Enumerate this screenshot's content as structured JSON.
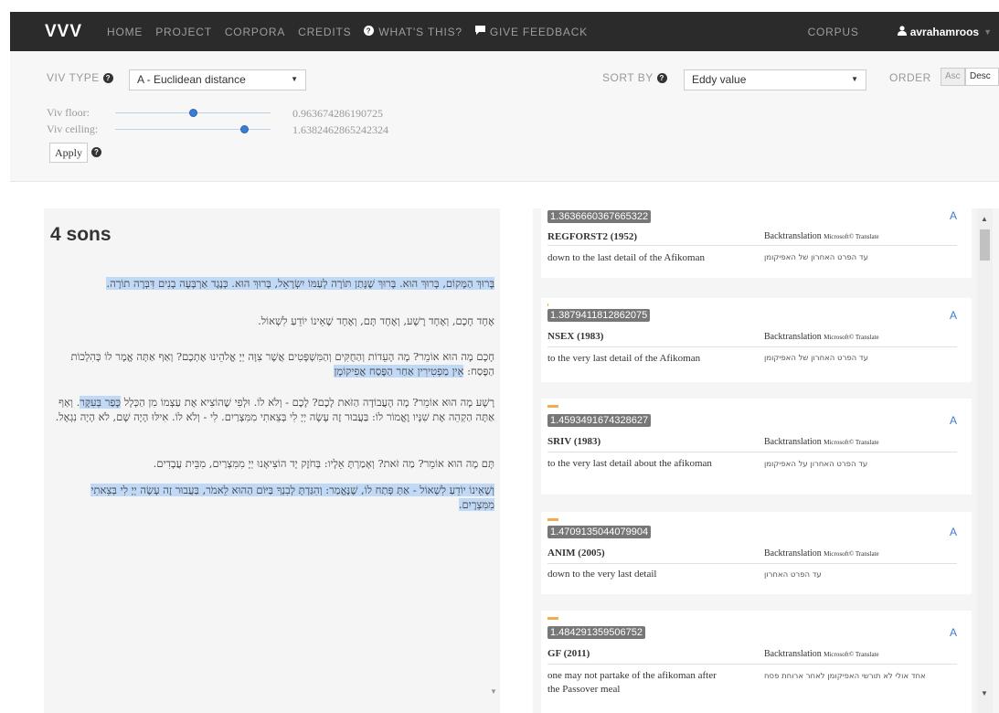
{
  "navbar": {
    "brand": "VVV",
    "links": [
      "HOME",
      "PROJECT",
      "CORPORA",
      "CREDITS"
    ],
    "whats_this": "WHAT'S THIS?",
    "feedback": "GIVE FEEDBACK",
    "corpus": "CORPUS",
    "user": "avrahamroos",
    "icons": {
      "whats_this": "question-circle-icon",
      "feedback": "comment-icon",
      "user": "user-icon"
    }
  },
  "controls": {
    "viv_type_label": "VIV TYPE",
    "viv_type_value": "A - Euclidean distance",
    "sort_by_label": "SORT BY",
    "sort_by_value": "Eddy value",
    "order_label": "ORDER",
    "order_asc": "Asc",
    "order_desc": "Desc",
    "order_selected": "Desc",
    "viv_floor_label": "Viv floor:",
    "viv_floor_value": "0.963674286190725",
    "viv_ceiling_label": "Viv ceiling:",
    "viv_ceiling_value": "1.6382462865242324",
    "apply": "Apply"
  },
  "text_panel": {
    "title": "4 sons",
    "paragraphs": [
      {
        "before": "",
        "highlight": "בָּרוּךְ הַמָּקוֹם, בָּרוּךְ הוּא. בָּרוּךְ שֶׁנָּתַן תּוֹרָה לְעַמּוֹ יִשְׂרָאֵל, בָּרוּךְ הוּא. כְּנֶגֶד אַרְבָּעָה בָנִים דִּבְּרָה תוֹרָה.",
        "after": ""
      },
      {
        "before": "אֶחָד חָכָם, וְאֶחָד רָשָׁע, וְאֶחָד תָּם, וְאֶחָד שֶׁאֵינוֹ יוֹדֵעַ לִשְׁאוֹל.",
        "highlight": "",
        "after": ""
      },
      {
        "before": "חָכָם מָה הוּא אוֹמֵר? מָה הָעֵדוֹת וְהַחֻקִּים וְהַמִּשְׁפָּטִים אֲשֶׁר צִוָּה יְיָ אֱלֹהֵינוּ אֶתְכֶם? וְאַף אַתָּה אֱמָר לוֹ כְּהִלְכוֹת הַפֶּסַח: ",
        "highlight": "אֵין מַפְטִירִין אַחַר הַפֶּסַח אֲפִיקוֹמָן",
        "after": ""
      },
      {
        "before": "רָשָׁע מָה הוּא אוֹמֵר? מָה הָעֲבוֹדָה הַזֹּאת לָכֶם? לָכֶם - וְלֹא לוֹ. וּלְפִי שֶׁהוֹצִיא אֶת עַצְמוֹ מִן הַכְּלָל ",
        "highlight": "כָּפַר בְּעִקָּר",
        "after": ". וְאַף אַתָּה הַקְהֵה אֶת שִׁנָּיו וֶאֱמוֹר לוֹ: בַּעֲבוּר זֶה עָשָׂה יְיָ לִי בְּצֵאתִי מִמִּצְרַיִם. לִי - וְלֹא לוֹ. אִילּוּ הָיָה שָׁם, לֹא הָיָה נִגְאָל."
      },
      {
        "before": "תָּם מָה הוּא אוֹמֵר? מַה זֹּאת? וְאָמַרְתָּ אֵלָיו: בְּחֹזֶק יָד הוֹצִיאָנוּ יְיָ מִמִּצְרַיִם, מִבֵּית עֲבָדִים.",
        "highlight": "",
        "after": ""
      },
      {
        "before": "",
        "highlight": "וְשֶׁאֵינוֹ יוֹדֵעַ לִשְׁאוֹל - אַתְּ פְּתַח לוֹ, שֶׁנֶּאֱמַר: וְהִגַּדְתָּ לְבִנְךָ בַּיּוֹם הַהוּא לֵאמֹר, בַּעֲבוּר זֶה עָשָׂה יְיָ לִי בְּצֵאתִי מִמִּצְרָיִם.",
        "after": ""
      }
    ]
  },
  "results": [
    {
      "score": "1.3636660367665322",
      "grade": "A",
      "source": "REGFORST2 (1952)",
      "backtranslation": "Backtranslation",
      "translator": "Microsoft© Translate",
      "english": "down to the last detail of the Afikoman",
      "hebrew": "עד הפרט האחרון של האפיקומן",
      "bar_count": 0
    },
    {
      "score": "1.3879411812862075",
      "grade": "A",
      "source": "NSEX (1983)",
      "backtranslation": "Backtranslation",
      "translator": "Microsoft© Translate",
      "english": "to the very last detail of the Afikoman",
      "hebrew": "עד הפרט האחרון של האפיקומן",
      "bar_count": 1
    },
    {
      "score": "1.4593491674328627",
      "grade": "A",
      "source": "SRIV (1983)",
      "backtranslation": "Backtranslation",
      "translator": "Microsoft© Translate",
      "english": "to the very last detail about the afikoman",
      "hebrew": "עד הפרט האחרון על האפיקומן",
      "bar_count": 1
    },
    {
      "score": "1.4709135044079904",
      "grade": "A",
      "source": "ANIM (2005)",
      "backtranslation": "Backtranslation",
      "translator": "Microsoft© Translate",
      "english": "down to the very last detail",
      "hebrew": "עד הפרט האחרון",
      "bar_count": 1
    },
    {
      "score": "1.484291359506752",
      "grade": "A",
      "source": "GF (2011)",
      "backtranslation": "Backtranslation",
      "translator": "Microsoft© Translate",
      "english": "one may not partake of the afikoman after the Passover meal",
      "hebrew": "אחד אולי לא תורשי האפיקומן לאחר ארוחת פסח",
      "bar_count": 1
    }
  ],
  "slider": {
    "floor_position": 0.55,
    "ceiling_position": 0.88
  }
}
